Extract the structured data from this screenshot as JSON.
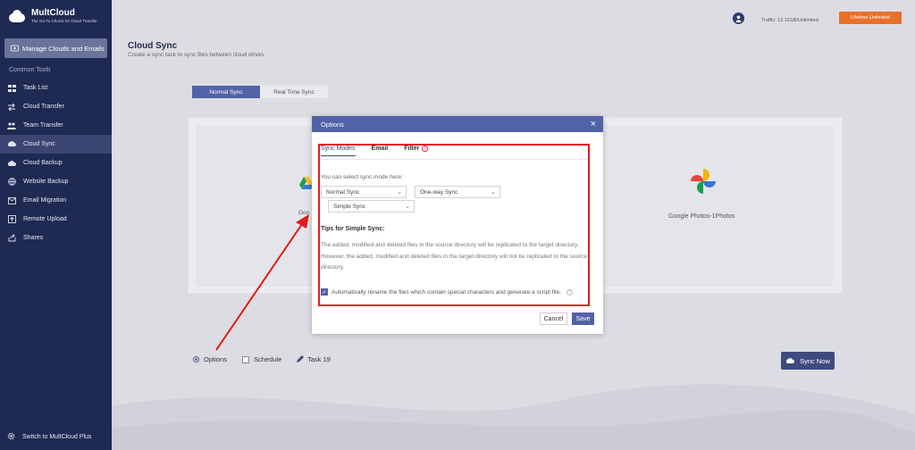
{
  "app": {
    "name": "MultCloud",
    "tagline": "The Go-To Choice for Cloud Transfer"
  },
  "sidebar": {
    "manage_button": "Manage Clouds and Emails",
    "section_label": "Common Tools",
    "items": [
      {
        "label": "Task List",
        "icon": "task-list-icon"
      },
      {
        "label": "Cloud Transfer",
        "icon": "transfer-icon"
      },
      {
        "label": "Team Transfer",
        "icon": "team-icon"
      },
      {
        "label": "Cloud Sync",
        "icon": "sync-icon",
        "active": true
      },
      {
        "label": "Cloud Backup",
        "icon": "cloud-backup-icon"
      },
      {
        "label": "Website Backup",
        "icon": "globe-icon"
      },
      {
        "label": "Email Migration",
        "icon": "email-icon"
      },
      {
        "label": "Remote Upload",
        "icon": "upload-icon"
      },
      {
        "label": "Shares",
        "icon": "share-icon"
      }
    ],
    "switch_label": "Switch to MultCloud Plus"
  },
  "header": {
    "traffic": "Traffic: 12.11GB/Unlimited",
    "lifetime_button": "Lifetime Unlimited"
  },
  "page": {
    "title": "Cloud Sync",
    "subtitle": "Create a sync task to sync files between cloud drives",
    "tabs": [
      "Normal Sync",
      "Real Time Sync"
    ],
    "source_label": "Goo",
    "target_label": "Google Photos-1Photos"
  },
  "bottom": {
    "options": "Options",
    "schedule": "Schedule",
    "task_name": "Task 19",
    "sync_now": "Sync Now"
  },
  "modal": {
    "title": "Options",
    "tabs": [
      "Sync Modes",
      "Email",
      "Filter"
    ],
    "select_label": "You can select sync mode here:",
    "mode_select": "Normal Sync",
    "direction_select": "One-way Sync",
    "sub_mode_select": "Simple Sync",
    "tips_title": "Tips for Simple Sync:",
    "tips_text": "The added, modified and deleted files in the source directory will be replicated to the target directory. However, the added, modified and deleted files in the target directory will not be replicated to the source directory.",
    "auto_rename": "Automatically rename the files which contain special characters and generate a script file.",
    "cancel": "Cancel",
    "save": "Save"
  },
  "colors": {
    "sidebar": "#1f2a52",
    "accent": "#5262a6",
    "orange": "#e8702a",
    "highlight": "#e21a1a"
  }
}
